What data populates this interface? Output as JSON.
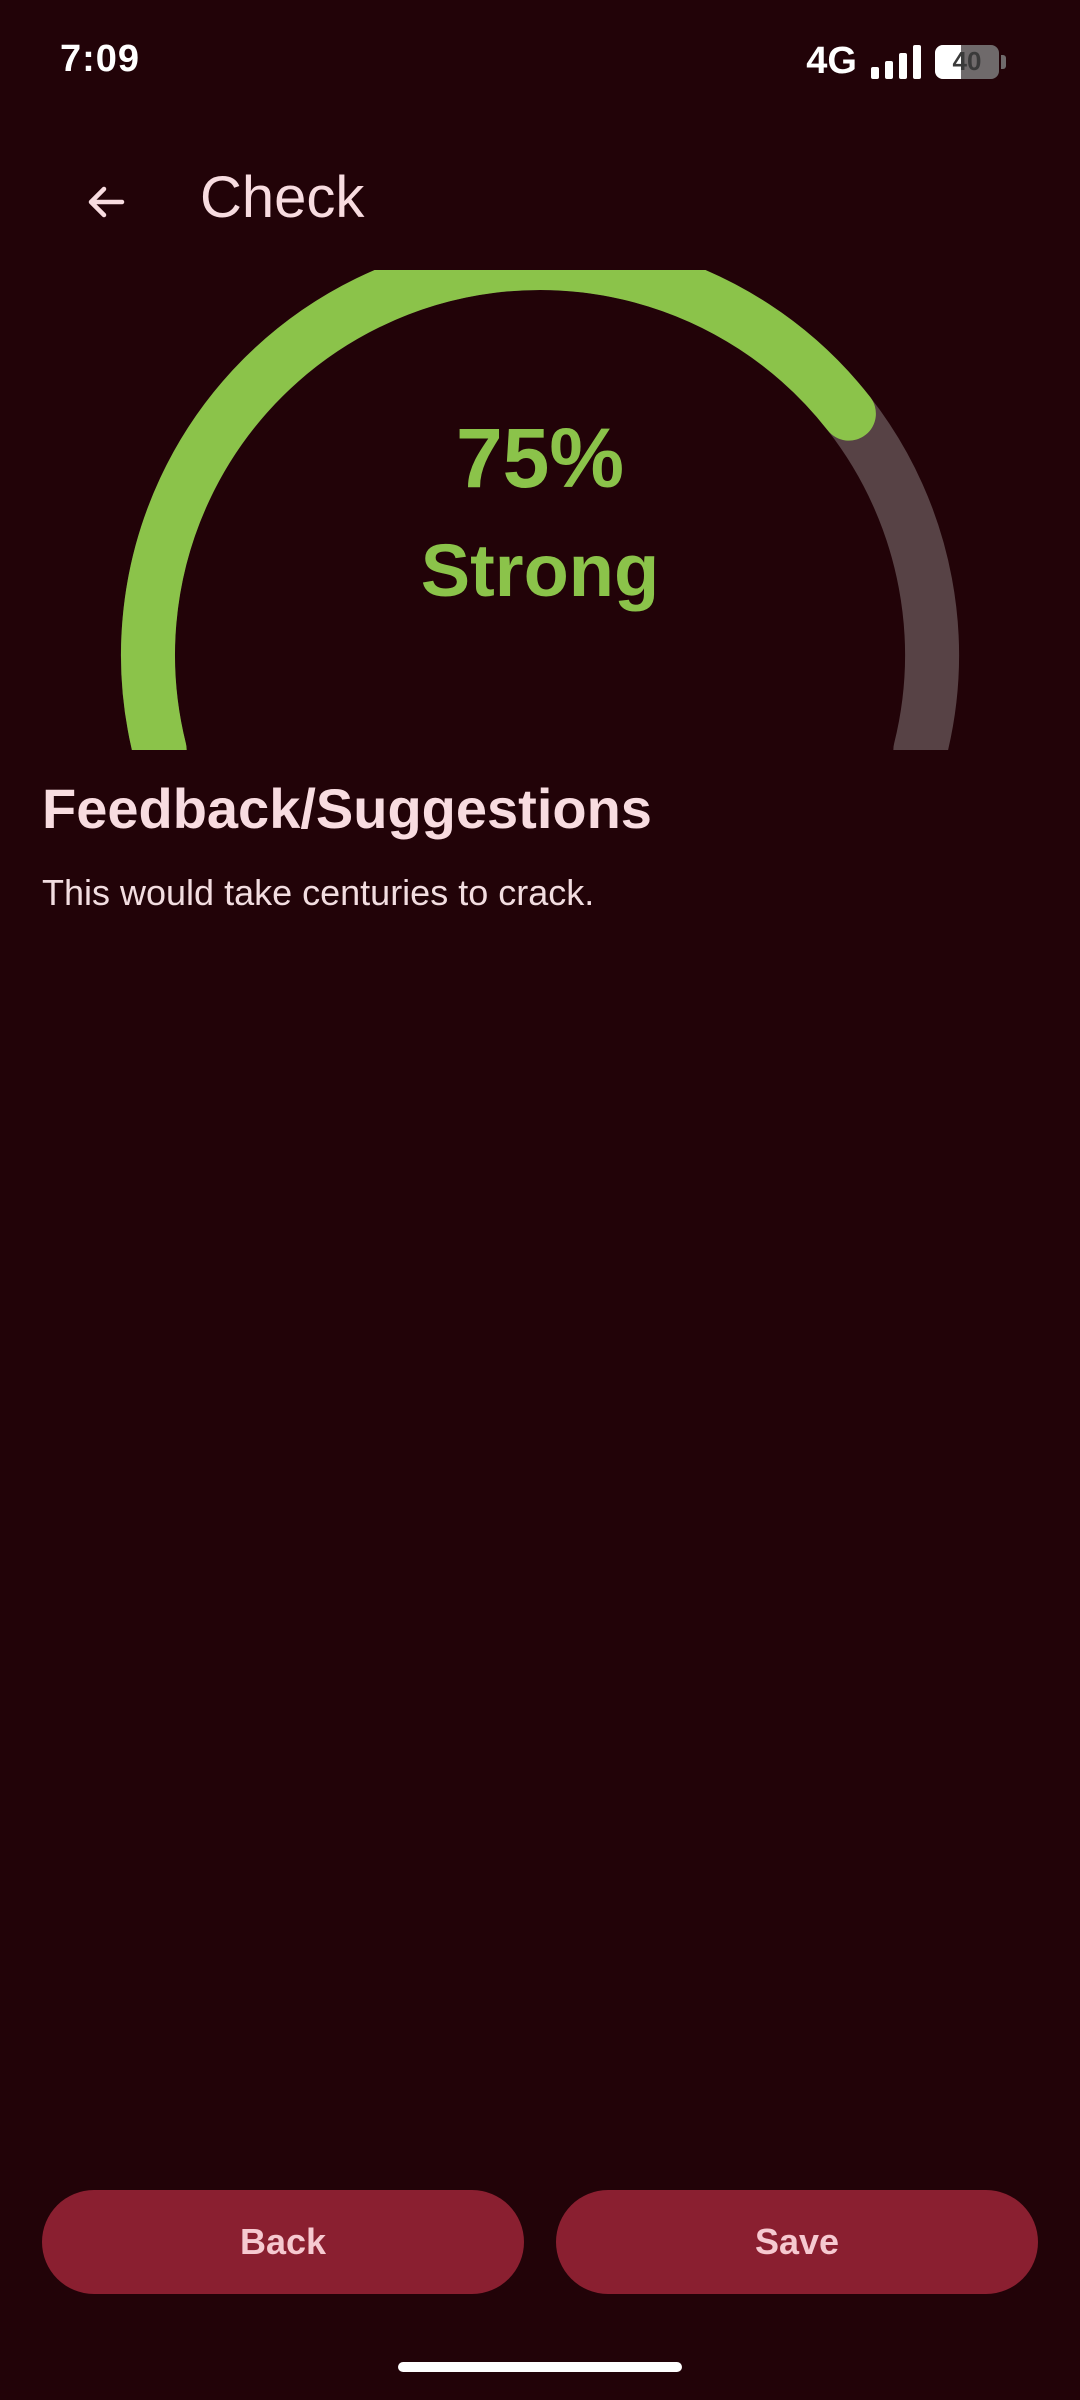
{
  "status_bar": {
    "time": "7:09",
    "network": "4G",
    "battery_level": "40",
    "battery_fraction": 0.4,
    "signal_bars": 4
  },
  "app_bar": {
    "title": "Check",
    "back_icon": "arrow-left-icon"
  },
  "gauge": {
    "percent_text": "75%",
    "value_fraction": 0.75,
    "strength_label": "Strong",
    "colors": {
      "progress": "#8BC34A",
      "track": "#574245"
    }
  },
  "feedback": {
    "title": "Feedback/Suggestions",
    "text": "This would take centuries to crack."
  },
  "buttons": {
    "back_label": "Back",
    "save_label": "Save"
  },
  "colors": {
    "background": "#220308",
    "button": "#8A1F30",
    "button_text": "#F6C9D0",
    "text": "#F8DCE0",
    "accent": "#8BC34A"
  }
}
